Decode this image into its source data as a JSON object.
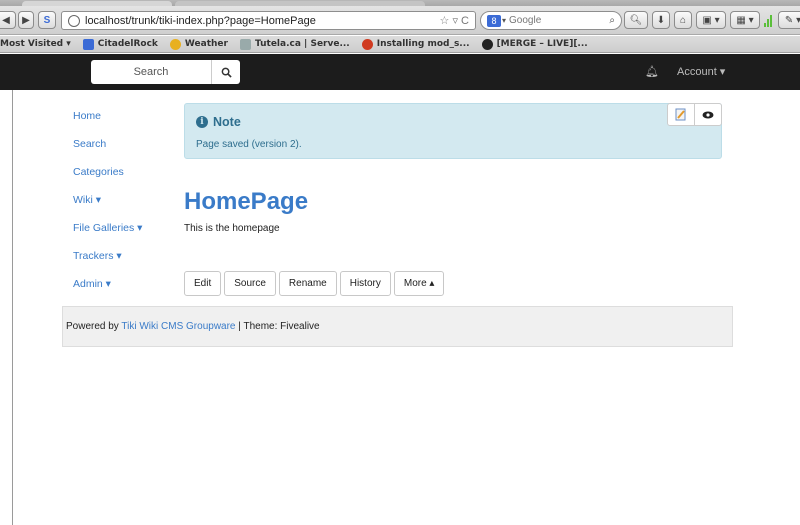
{
  "browser": {
    "url": "localhost/trunk/tiki-index.php?page=HomePage",
    "search_placeholder": "Google",
    "bookmarks": [
      {
        "label": "Most Visited ▾",
        "color": ""
      },
      {
        "label": "CitadelRock",
        "color": "#3b6bd6"
      },
      {
        "label": "Weather",
        "color": "#e8b020"
      },
      {
        "label": "Tutela.ca | Serve...",
        "color": "#9aa"
      },
      {
        "label": "Installing mod_s...",
        "color": "#d03a20"
      },
      {
        "label": "[MERGE – LIVE][...",
        "color": "#222"
      }
    ]
  },
  "topbar": {
    "search_placeholder": "Search",
    "account_label": "Account ▾"
  },
  "sidebar": {
    "items": [
      {
        "label": "Home"
      },
      {
        "label": "Search"
      },
      {
        "label": "Categories"
      },
      {
        "label": "Wiki ▾"
      },
      {
        "label": "File Galleries ▾"
      },
      {
        "label": "Trackers ▾"
      },
      {
        "label": "Admin ▾"
      }
    ]
  },
  "note": {
    "title": "Note",
    "message": "Page saved (version 2)."
  },
  "page": {
    "title": "HomePage",
    "body": "This is the homepage"
  },
  "actions": [
    {
      "label": "Edit"
    },
    {
      "label": "Source"
    },
    {
      "label": "Rename"
    },
    {
      "label": "History"
    },
    {
      "label": "More ▴"
    }
  ],
  "footer": {
    "prefix": "Powered by ",
    "link": "Tiki Wiki CMS Groupware",
    "suffix": " | Theme: Fivealive"
  }
}
